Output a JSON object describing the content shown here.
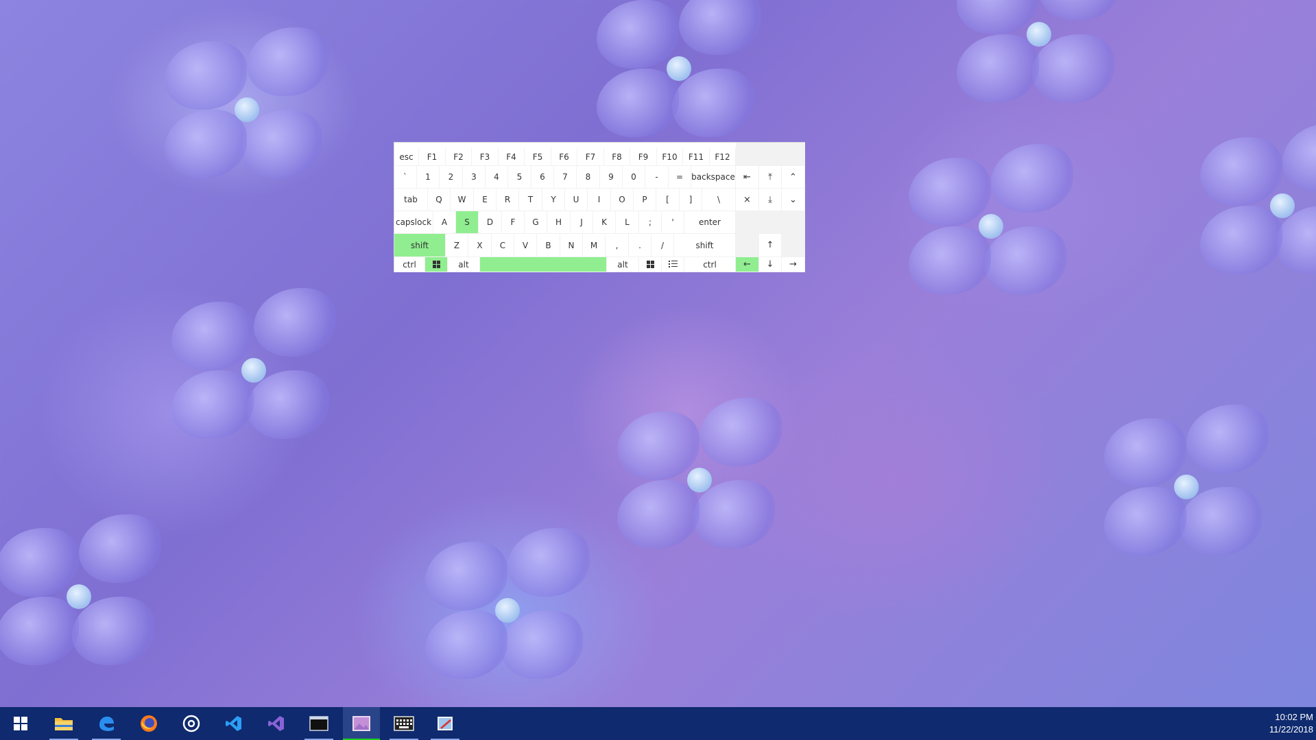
{
  "keyboard": {
    "row_fn": [
      "esc",
      "F1",
      "F2",
      "F3",
      "F4",
      "F5",
      "F6",
      "F7",
      "F8",
      "F9",
      "F10",
      "F11",
      "F12"
    ],
    "row_num": [
      "`",
      "1",
      "2",
      "3",
      "4",
      "5",
      "6",
      "7",
      "8",
      "9",
      "0",
      "-",
      "=",
      "backspace"
    ],
    "row_tab": [
      "tab",
      "Q",
      "W",
      "E",
      "R",
      "T",
      "Y",
      "U",
      "I",
      "O",
      "P",
      "[",
      "]",
      "\\"
    ],
    "row_caps": [
      "capslock",
      "A",
      "S",
      "D",
      "F",
      "G",
      "H",
      "J",
      "K",
      "L",
      ";",
      "'",
      "enter"
    ],
    "row_shift": [
      "shift",
      "Z",
      "X",
      "C",
      "V",
      "B",
      "N",
      "M",
      ",",
      ".",
      "/",
      "shift"
    ],
    "row_bottom": [
      "ctrl",
      "alt",
      "alt",
      "ctrl"
    ],
    "nav_top": [
      "⇤",
      "⤒",
      "⌃"
    ],
    "nav_mid": [
      "×",
      "⤓",
      "⌄"
    ],
    "arrows": [
      "↑",
      "←",
      "↓",
      "→"
    ],
    "active_keys": [
      "S",
      "shift-left",
      "win-left",
      "space",
      "arrow-left"
    ],
    "accent_color": "#90ee90",
    "status_color": "#118811"
  },
  "taskbar": {
    "time": "10:02 PM",
    "date": "11/22/2018",
    "items": [
      "start",
      "file-explorer",
      "edge",
      "firefox",
      "media",
      "vscode",
      "visual-studio",
      "terminal",
      "photos",
      "keyboard",
      "paint"
    ]
  }
}
